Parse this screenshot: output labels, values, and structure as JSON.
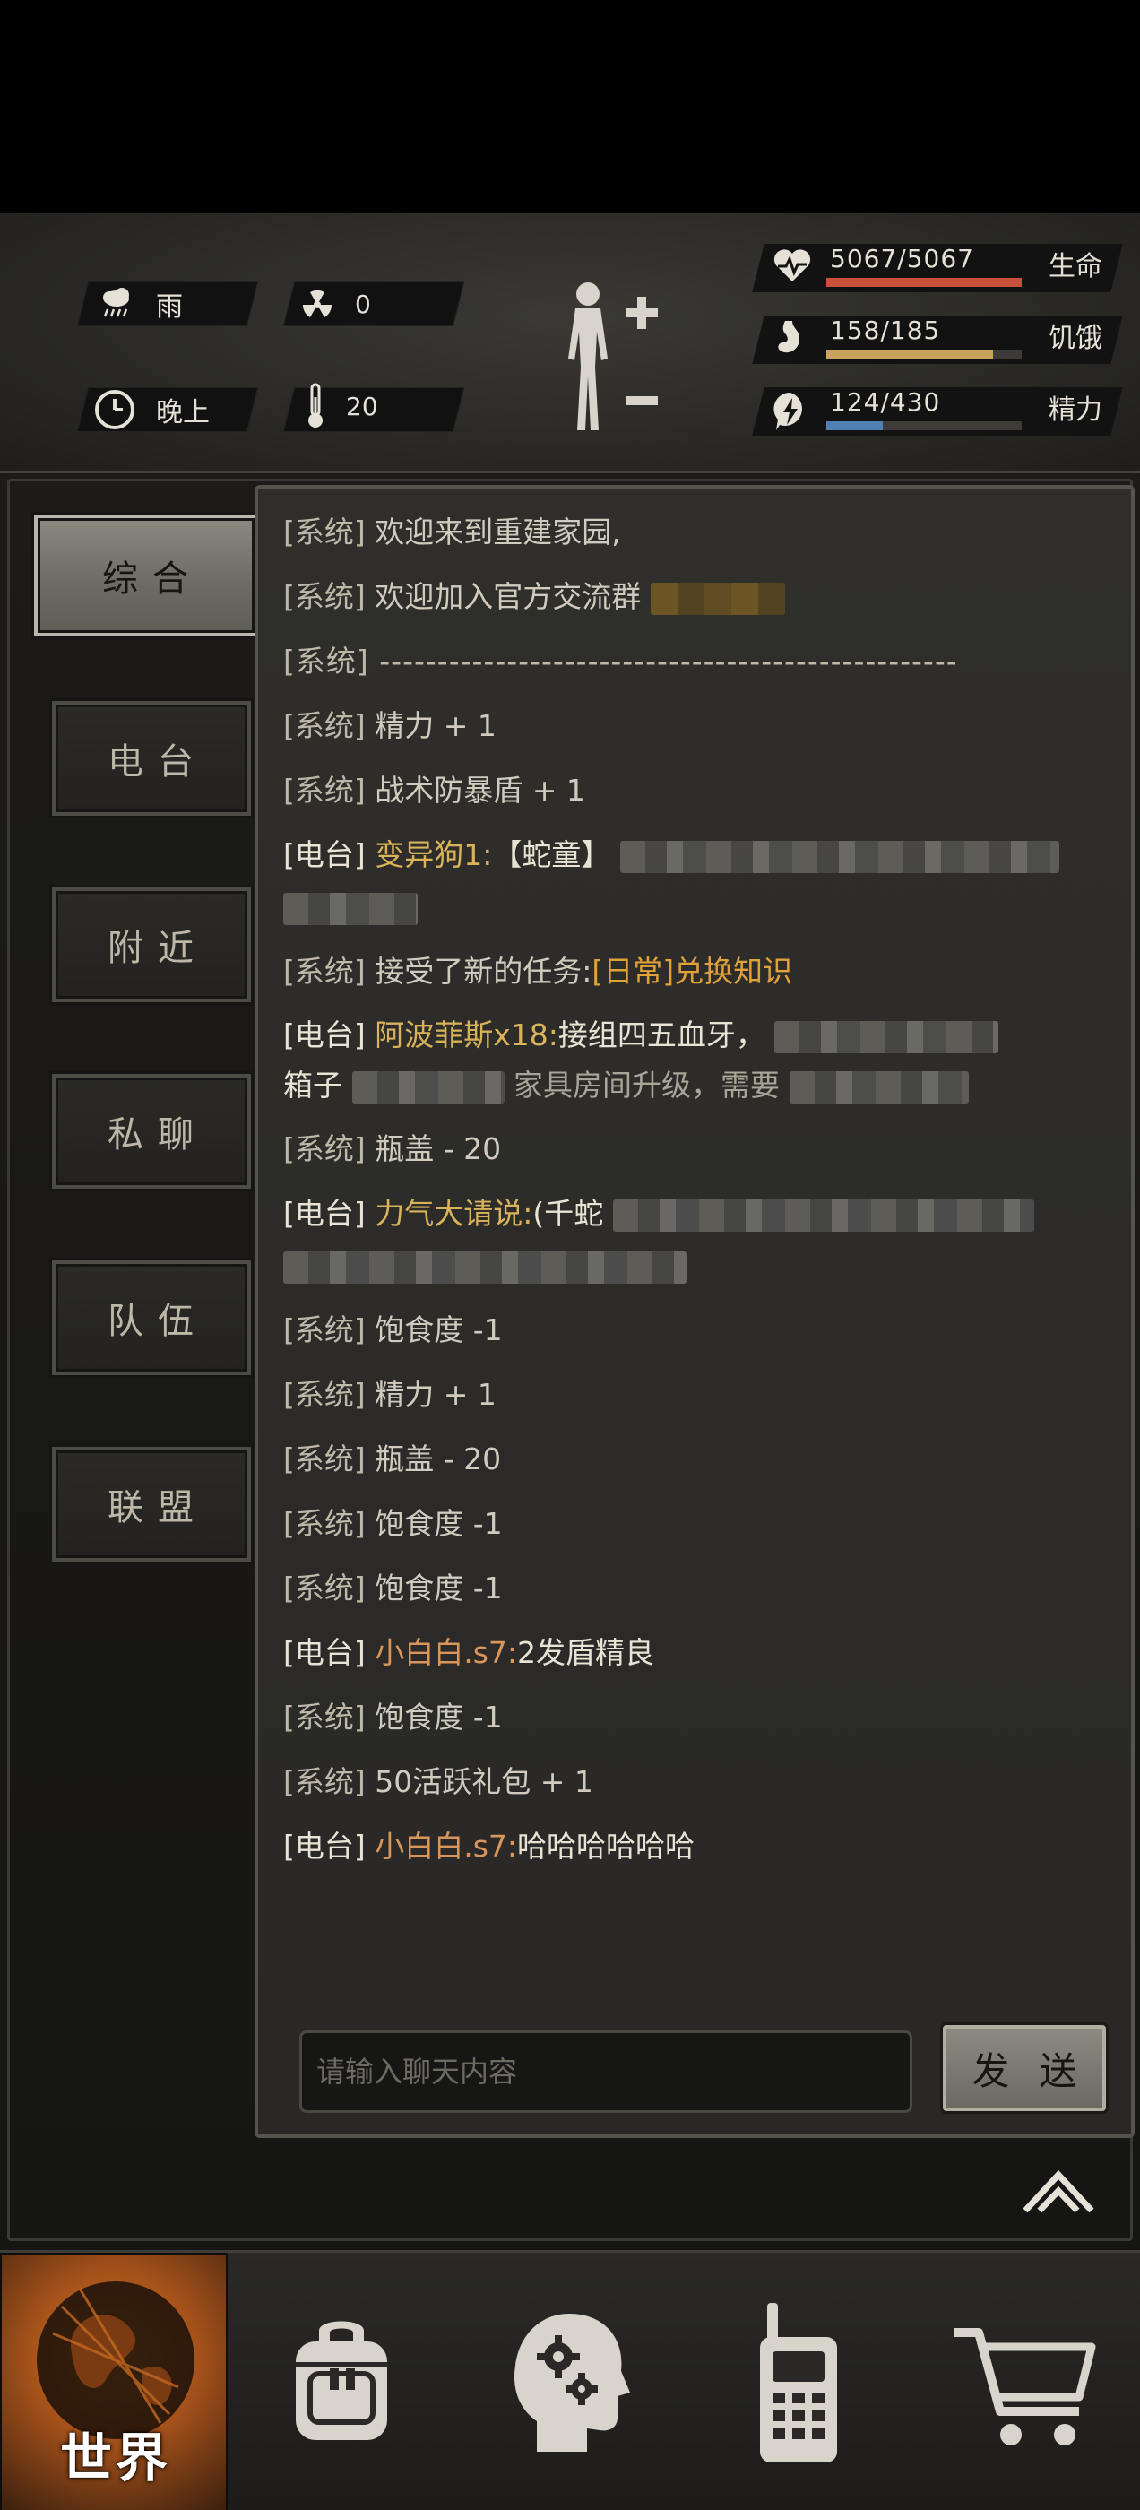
{
  "hud": {
    "weather": {
      "label": "雨",
      "icon": "rain-cloud-icon"
    },
    "radiation": {
      "value": "0",
      "icon": "radiation-icon"
    },
    "time_of_day": {
      "label": "晚上",
      "icon": "clock-icon"
    },
    "temperature": {
      "value": "20",
      "icon": "thermometer-icon"
    },
    "body_status": {
      "icon": "body-status-icon"
    },
    "stats": [
      {
        "name": "生命",
        "value": "5067/5067",
        "fill": 1.0,
        "color": "#c9503a",
        "icon": "heart-pulse-icon"
      },
      {
        "name": "饥饿",
        "value": "158/185",
        "fill": 0.854,
        "color": "#c9a25e",
        "icon": "stomach-icon"
      },
      {
        "name": "精力",
        "value": "124/430",
        "fill": 0.288,
        "color": "#4f7fb3",
        "icon": "energy-bolt-icon"
      }
    ]
  },
  "tabs": [
    {
      "label": "综合",
      "active": true
    },
    {
      "label": "电台",
      "active": false
    },
    {
      "label": "附近",
      "active": false
    },
    {
      "label": "私聊",
      "active": false
    },
    {
      "label": "队伍",
      "active": false
    },
    {
      "label": "联盟",
      "active": false
    }
  ],
  "chat": {
    "messages": [
      {
        "tag": "[系统]",
        "text": "欢迎来到重建家园,"
      },
      {
        "tag": "[系统]",
        "text": " 欢迎加入官方交流群"
      },
      {
        "tag": "[系统]",
        "text": "--------------------------------------------------"
      },
      {
        "tag": "[系统]",
        "text": "精力 + 1"
      },
      {
        "tag": "[系统]",
        "text": "战术防暴盾 + 1"
      },
      {
        "tag": "[电台]",
        "name": "变异狗1:",
        "text": "【蛇童】"
      },
      {
        "tag": "[系统]",
        "text": "接受了新的任务:",
        "task": "[日常]兑换知识"
      },
      {
        "tag": "[电台]",
        "name": "阿波菲斯x18:",
        "text": "接组四五血牙，",
        "text2": "箱子",
        "text3": "家具房间升级，需要",
        "text4": ""
      },
      {
        "tag": "[系统]",
        "text": "瓶盖 - 20"
      },
      {
        "tag": "[电台]",
        "name": "力气大请说:",
        "text": "(千蛇"
      },
      {
        "tag": "[系统]",
        "text": "饱食度 -1"
      },
      {
        "tag": "[系统]",
        "text": "精力 + 1"
      },
      {
        "tag": "[系统]",
        "text": "瓶盖 - 20"
      },
      {
        "tag": "[系统]",
        "text": "饱食度 -1"
      },
      {
        "tag": "[系统]",
        "text": "饱食度 -1"
      },
      {
        "tag": "[电台]",
        "name": "小白白.s7:",
        "text": "2发盾精良"
      },
      {
        "tag": "[系统]",
        "text": "饱食度 -1"
      },
      {
        "tag": "[系统]",
        "text": "50活跃礼包 + 1"
      },
      {
        "tag": "[电台]",
        "name": "小白白.s7:",
        "text": "哈哈哈哈哈哈"
      }
    ],
    "input_placeholder": "请输入聊天内容",
    "send_label": "发 送"
  },
  "bottom_nav": [
    {
      "label": "世界",
      "icon": "globe-icon",
      "active": true
    },
    {
      "label": "",
      "icon": "backpack-icon",
      "active": false
    },
    {
      "label": "",
      "icon": "head-gears-icon",
      "active": false
    },
    {
      "label": "",
      "icon": "walkie-talkie-icon",
      "active": false
    },
    {
      "label": "",
      "icon": "shopping-cart-icon",
      "active": false
    }
  ],
  "colors": {
    "accent": "#d9b35a",
    "name_orange": "#d9965b",
    "task": "#e0a33a"
  }
}
